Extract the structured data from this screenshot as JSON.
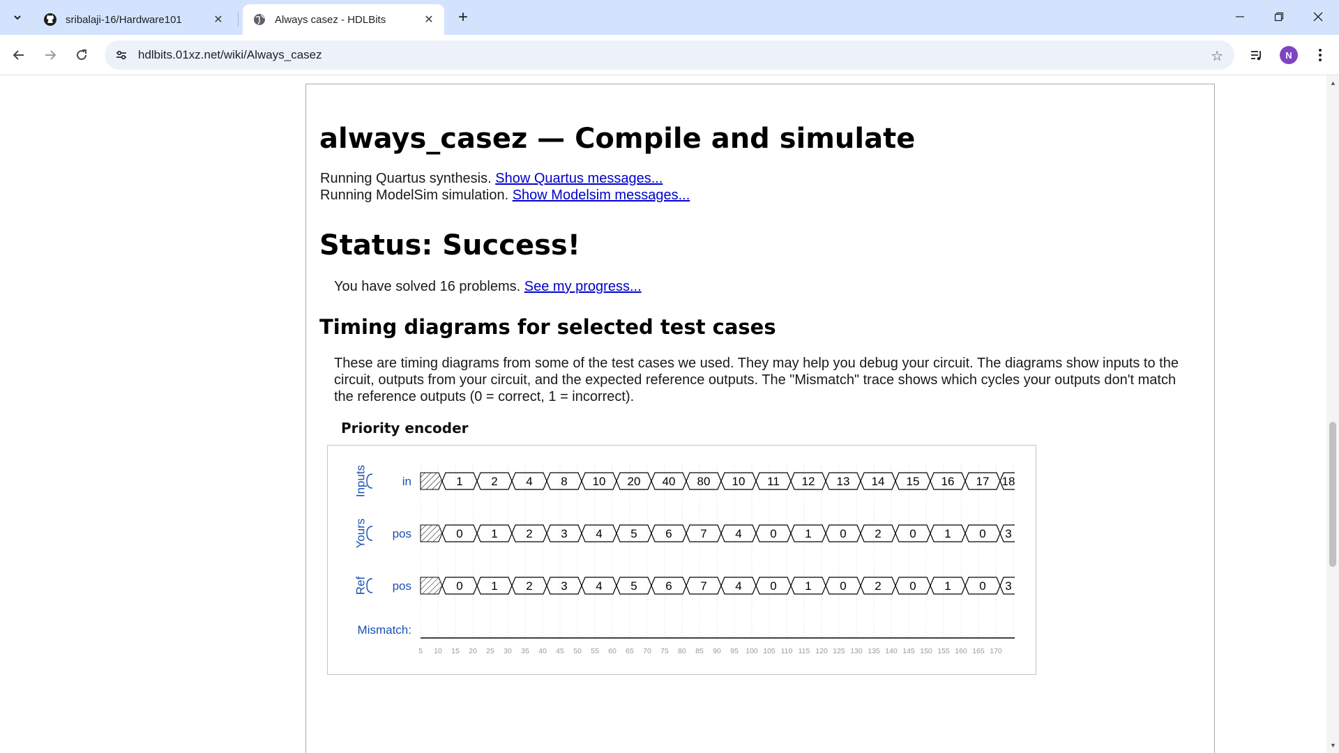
{
  "browser": {
    "tabs": [
      {
        "title": "sribalaji-16/Hardware101",
        "favicon": "github-icon",
        "active": false
      },
      {
        "title": "Always casez - HDLBits",
        "favicon": "globe-icon",
        "active": true
      }
    ],
    "url": "hdlbits.01xz.net/wiki/Always_casez",
    "profile_initial": "N"
  },
  "page": {
    "title": "always_casez — Compile and simulate",
    "quartus_text": "Running Quartus synthesis.",
    "quartus_link": "Show Quartus messages...",
    "modelsim_text": "Running ModelSim simulation.",
    "modelsim_link": "Show Modelsim messages...",
    "status_heading": "Status: Success!",
    "solved_text": "You have solved 16 problems.",
    "progress_link": "See my progress...",
    "timing_heading": "Timing diagrams for selected test cases",
    "timing_description": "These are timing diagrams from some of the test cases we used. They may help you debug your circuit. The diagrams show inputs to the circuit, outputs from your circuit, and the expected reference outputs. The \"Mismatch\" trace shows which cycles your outputs don't match the reference outputs (0 = correct, 1 = incorrect).",
    "diagram_caption": "Priority encoder"
  },
  "timing": {
    "groups": [
      {
        "group": "Inputs",
        "signal": "in",
        "values": [
          "1",
          "2",
          "4",
          "8",
          "10",
          "20",
          "40",
          "80",
          "10",
          "11",
          "12",
          "13",
          "14",
          "15",
          "16",
          "17",
          "18"
        ]
      },
      {
        "group": "Yours",
        "signal": "pos",
        "values": [
          "0",
          "1",
          "2",
          "3",
          "4",
          "5",
          "6",
          "7",
          "4",
          "0",
          "1",
          "0",
          "2",
          "0",
          "1",
          "0",
          "3"
        ]
      },
      {
        "group": "Ref",
        "signal": "pos",
        "values": [
          "0",
          "1",
          "2",
          "3",
          "4",
          "5",
          "6",
          "7",
          "4",
          "0",
          "1",
          "0",
          "2",
          "0",
          "1",
          "0",
          "3"
        ]
      }
    ],
    "mismatch_label": "Mismatch:",
    "time_ticks": [
      "5",
      "10",
      "15",
      "20",
      "25",
      "30",
      "35",
      "40",
      "45",
      "50",
      "55",
      "60",
      "65",
      "70",
      "75",
      "80",
      "85",
      "90",
      "95",
      "100",
      "105",
      "110",
      "115",
      "120",
      "125",
      "130",
      "135",
      "140",
      "145",
      "150",
      "155",
      "160",
      "165",
      "170"
    ],
    "colors": {
      "label": "#1a4fb4",
      "trace": "#000000",
      "grid": "#bbbbbb",
      "tick": "#999999"
    }
  }
}
